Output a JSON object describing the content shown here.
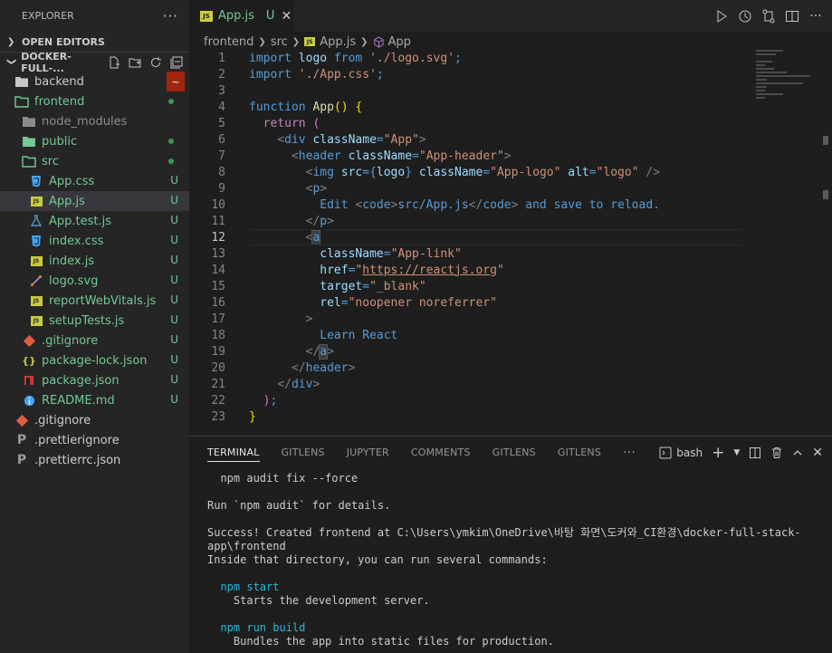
{
  "sidebar": {
    "title": "EXPLORER",
    "more": "···",
    "open_editors": "OPEN EDITORS",
    "project": "DOCKER-FULL-...",
    "tree": [
      {
        "name": "backend",
        "type": "folder",
        "color": "white",
        "status": "~"
      },
      {
        "name": "frontend",
        "type": "folder-open",
        "color": "green",
        "status": "dot"
      },
      {
        "name": "node_modules",
        "type": "folder",
        "color": "gray",
        "status": ""
      },
      {
        "name": "public",
        "type": "folder",
        "color": "green",
        "status": "dot"
      },
      {
        "name": "src",
        "type": "folder-open",
        "color": "green",
        "status": "dot"
      },
      {
        "name": "App.css",
        "type": "css",
        "color": "green",
        "status": "U"
      },
      {
        "name": "App.js",
        "type": "js",
        "color": "green",
        "status": "U"
      },
      {
        "name": "App.test.js",
        "type": "test",
        "color": "green",
        "status": "U"
      },
      {
        "name": "index.css",
        "type": "css",
        "color": "green",
        "status": "U"
      },
      {
        "name": "index.js",
        "type": "js",
        "color": "green",
        "status": "U"
      },
      {
        "name": "logo.svg",
        "type": "svg",
        "color": "green",
        "status": "U"
      },
      {
        "name": "reportWebVitals.js",
        "type": "js",
        "color": "green",
        "status": "U"
      },
      {
        "name": "setupTests.js",
        "type": "js",
        "color": "green",
        "status": "U"
      },
      {
        "name": ".gitignore",
        "type": "git",
        "color": "green",
        "status": "U"
      },
      {
        "name": "package-lock.json",
        "type": "json",
        "color": "green",
        "status": "U"
      },
      {
        "name": "package.json",
        "type": "npm",
        "color": "green",
        "status": "U"
      },
      {
        "name": "README.md",
        "type": "info",
        "color": "green",
        "status": "U"
      },
      {
        "name": ".gitignore",
        "type": "git",
        "color": "white",
        "status": ""
      },
      {
        "name": ".prettierignore",
        "type": "prettier",
        "color": "white",
        "status": ""
      },
      {
        "name": ".prettierrc.json",
        "type": "prettier",
        "color": "white",
        "status": ""
      }
    ]
  },
  "editor": {
    "tab": {
      "label": "App.js",
      "status": "U",
      "close": "✕",
      "icon": "JS"
    },
    "breadcrumb": [
      "frontend",
      "src",
      "App.js",
      "App"
    ],
    "lines": [
      [
        [
          "k",
          "import"
        ],
        [
          "v",
          " logo"
        ],
        [
          "k",
          " from"
        ],
        [
          "s",
          " './logo.svg'"
        ],
        [
          "t",
          ";"
        ]
      ],
      [
        [
          "k",
          "import"
        ],
        [
          "s",
          " './App.css'"
        ],
        [
          "t",
          ";"
        ]
      ],
      [],
      [
        [
          "k",
          "function"
        ],
        [
          "f",
          " App"
        ],
        [
          "y",
          "()"
        ],
        [
          "t",
          " "
        ],
        [
          "y",
          "{"
        ]
      ],
      [
        [
          "t",
          "  "
        ],
        [
          "kc",
          "return"
        ],
        [
          "t",
          " "
        ],
        [
          "p2",
          "("
        ]
      ],
      [
        [
          "t",
          "    "
        ],
        [
          "tg",
          "<"
        ],
        [
          "k",
          "div"
        ],
        [
          "v",
          " className"
        ],
        [
          "t",
          "="
        ],
        [
          "s",
          "\"App\""
        ],
        [
          "tg",
          ">"
        ]
      ],
      [
        [
          "t",
          "      "
        ],
        [
          "tg",
          "<"
        ],
        [
          "k",
          "header"
        ],
        [
          "v",
          " className"
        ],
        [
          "t",
          "="
        ],
        [
          "s",
          "\"App-header\""
        ],
        [
          "tg",
          ">"
        ]
      ],
      [
        [
          "t",
          "        "
        ],
        [
          "tg",
          "<"
        ],
        [
          "k",
          "img"
        ],
        [
          "v",
          " src"
        ],
        [
          "t",
          "="
        ],
        [
          "k",
          "{"
        ],
        [
          "v",
          "logo"
        ],
        [
          "k",
          "}"
        ],
        [
          "v",
          " className"
        ],
        [
          "t",
          "="
        ],
        [
          "s",
          "\"App-logo\""
        ],
        [
          "v",
          " alt"
        ],
        [
          "t",
          "="
        ],
        [
          "s",
          "\"logo\""
        ],
        [
          "tg",
          " />"
        ]
      ],
      [
        [
          "t",
          "        "
        ],
        [
          "tg",
          "<"
        ],
        [
          "k",
          "p"
        ],
        [
          "tg",
          ">"
        ]
      ],
      [
        [
          "t",
          "          Edit "
        ],
        [
          "tg",
          "<"
        ],
        [
          "k",
          "code"
        ],
        [
          "tg",
          ">"
        ],
        [
          "t",
          "src/App.js"
        ],
        [
          "tg",
          "</"
        ],
        [
          "k",
          "code"
        ],
        [
          "tg",
          ">"
        ],
        [
          "t",
          " and save to reload."
        ]
      ],
      [
        [
          "t",
          "        "
        ],
        [
          "tg",
          "</"
        ],
        [
          "k",
          "p"
        ],
        [
          "tg",
          ">"
        ]
      ],
      [
        [
          "t",
          "        "
        ],
        [
          "tg",
          "<"
        ],
        [
          "k",
          "a"
        ]
      ],
      [
        [
          "t",
          "          "
        ],
        [
          "v",
          "className"
        ],
        [
          "t",
          "="
        ],
        [
          "s",
          "\"App-link\""
        ]
      ],
      [
        [
          "t",
          "          "
        ],
        [
          "v",
          "href"
        ],
        [
          "t",
          "="
        ],
        [
          "s",
          "\""
        ],
        [
          "su",
          "https://reactjs.org"
        ],
        [
          "s",
          "\""
        ]
      ],
      [
        [
          "t",
          "          "
        ],
        [
          "v",
          "target"
        ],
        [
          "t",
          "="
        ],
        [
          "s",
          "\"_blank\""
        ]
      ],
      [
        [
          "t",
          "          "
        ],
        [
          "v",
          "rel"
        ],
        [
          "t",
          "="
        ],
        [
          "s",
          "\"noopener noreferrer\""
        ]
      ],
      [
        [
          "t",
          "        "
        ],
        [
          "tg",
          ">"
        ]
      ],
      [
        [
          "t",
          "          Learn React"
        ]
      ],
      [
        [
          "t",
          "        "
        ],
        [
          "tg",
          "</"
        ],
        [
          "k",
          "a"
        ],
        [
          "tg",
          ">"
        ]
      ],
      [
        [
          "t",
          "      "
        ],
        [
          "tg",
          "</"
        ],
        [
          "k",
          "header"
        ],
        [
          "tg",
          ">"
        ]
      ],
      [
        [
          "t",
          "    "
        ],
        [
          "tg",
          "</"
        ],
        [
          "k",
          "div"
        ],
        [
          "tg",
          ">"
        ]
      ],
      [
        [
          "t",
          "  "
        ],
        [
          "p2",
          ")"
        ],
        [
          "t",
          ";"
        ]
      ],
      [
        [
          "y",
          "}"
        ]
      ]
    ],
    "current_line": 12
  },
  "panel": {
    "tabs": [
      "TERMINAL",
      "GITLENS",
      "JUPYTER",
      "COMMENTS",
      "GITLENS",
      "GITLENS"
    ],
    "more": "···",
    "shell": "bash",
    "terminal_lines": [
      {
        "text": "  npm audit fix --force",
        "kind": "plain"
      },
      {
        "text": "",
        "kind": "plain"
      },
      {
        "text": "Run `npm audit` for details.",
        "kind": "plain"
      },
      {
        "text": "",
        "kind": "plain"
      },
      {
        "text": "Success! Created frontend at C:\\Users\\ymkim\\OneDrive\\바탕 화면\\도커와_CI환경\\docker-full-stack-",
        "kind": "plain"
      },
      {
        "text": "app\\frontend",
        "kind": "plain"
      },
      {
        "text": "Inside that directory, you can run several commands:",
        "kind": "plain"
      },
      {
        "text": "",
        "kind": "plain"
      },
      {
        "text": "  npm start",
        "kind": "cmd"
      },
      {
        "text": "    Starts the development server.",
        "kind": "plain"
      },
      {
        "text": "",
        "kind": "plain"
      },
      {
        "text": "  npm run build",
        "kind": "cmd"
      },
      {
        "text": "    Bundles the app into static files for production.",
        "kind": "plain"
      }
    ]
  },
  "colors": {
    "accent": "#007acc",
    "git_added": "#73c991",
    "git_modified": "#a1260d",
    "js_icon": "#cbcb41"
  }
}
